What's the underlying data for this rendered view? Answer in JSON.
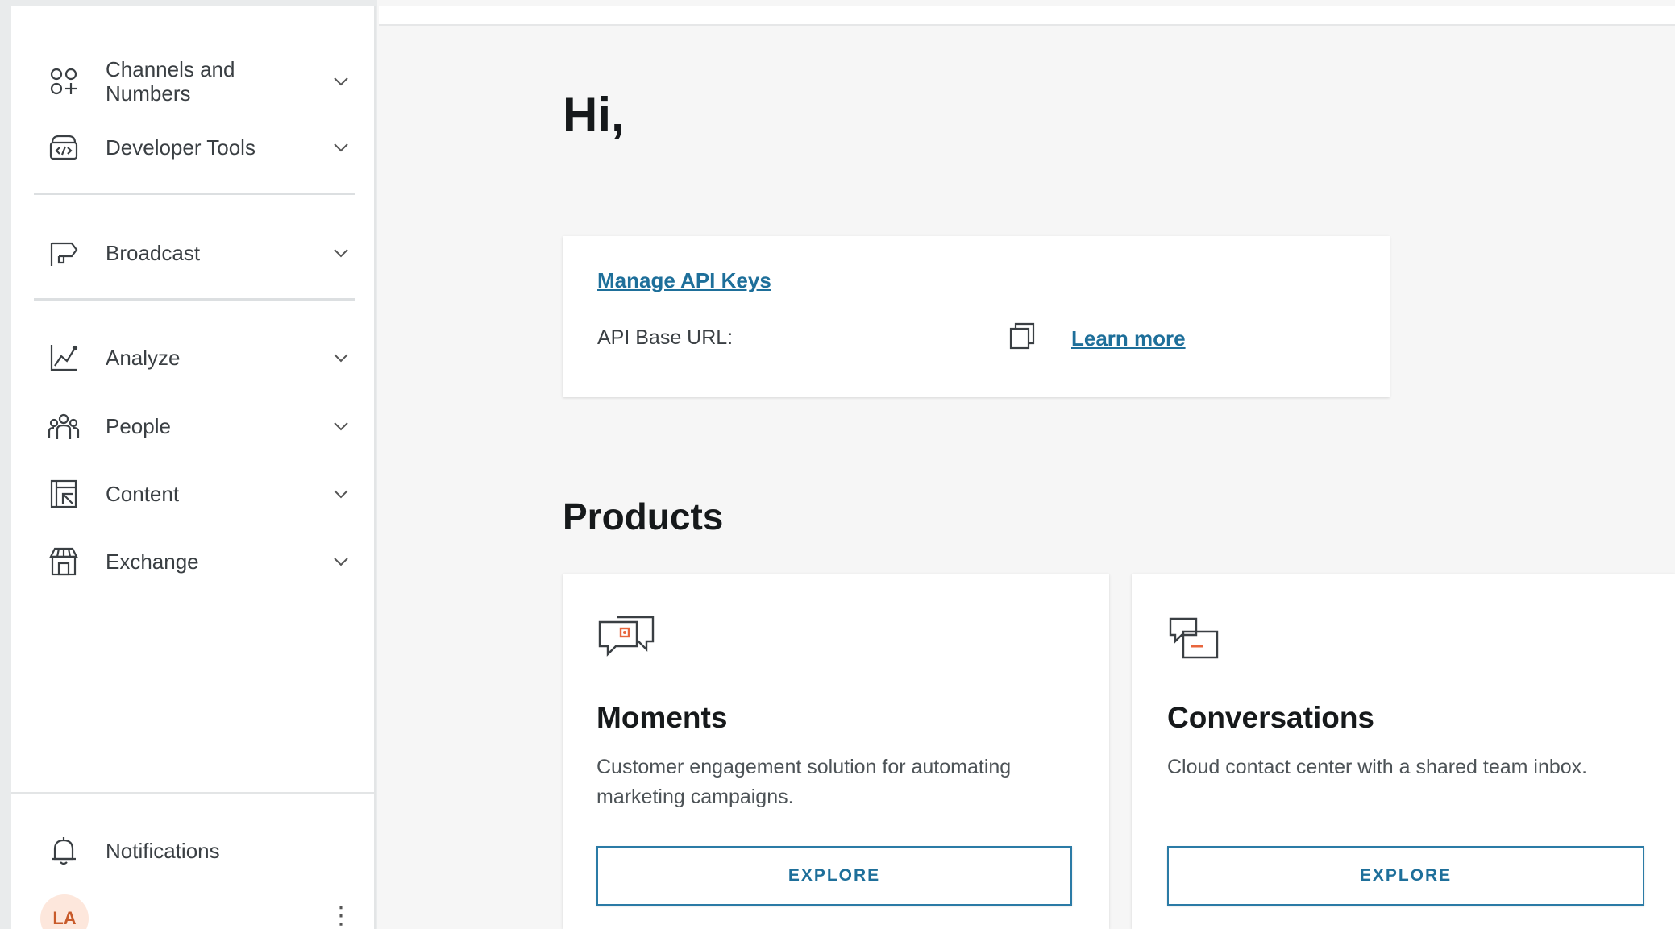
{
  "sidebar": {
    "items": [
      {
        "label": "Channels and Numbers",
        "icon": "channels-icon"
      },
      {
        "label": "Developer Tools",
        "icon": "developer-tools-icon"
      },
      {
        "label": "Broadcast",
        "icon": "megaphone-icon"
      },
      {
        "label": "Analyze",
        "icon": "chart-icon"
      },
      {
        "label": "People",
        "icon": "people-icon"
      },
      {
        "label": "Content",
        "icon": "content-icon"
      },
      {
        "label": "Exchange",
        "icon": "store-icon"
      }
    ],
    "footer": {
      "notifications_label": "Notifications",
      "avatar_initials": "LA",
      "more_glyph": "⋮"
    }
  },
  "main": {
    "greeting": "Hi,",
    "api_card": {
      "manage_link": "Manage API Keys",
      "base_url_label": "API Base URL:",
      "learn_more": "Learn more"
    },
    "products_title": "Products",
    "products": [
      {
        "title": "Moments",
        "description": "Customer engagement solution for automating marketing campaigns.",
        "button": "EXPLORE"
      },
      {
        "title": "Conversations",
        "description": "Cloud contact center with a shared team inbox.",
        "button": "EXPLORE"
      }
    ]
  },
  "colors": {
    "link": "#1e6f9a",
    "accent_orange": "#e8663d",
    "avatar_bg": "#fde7dc"
  }
}
